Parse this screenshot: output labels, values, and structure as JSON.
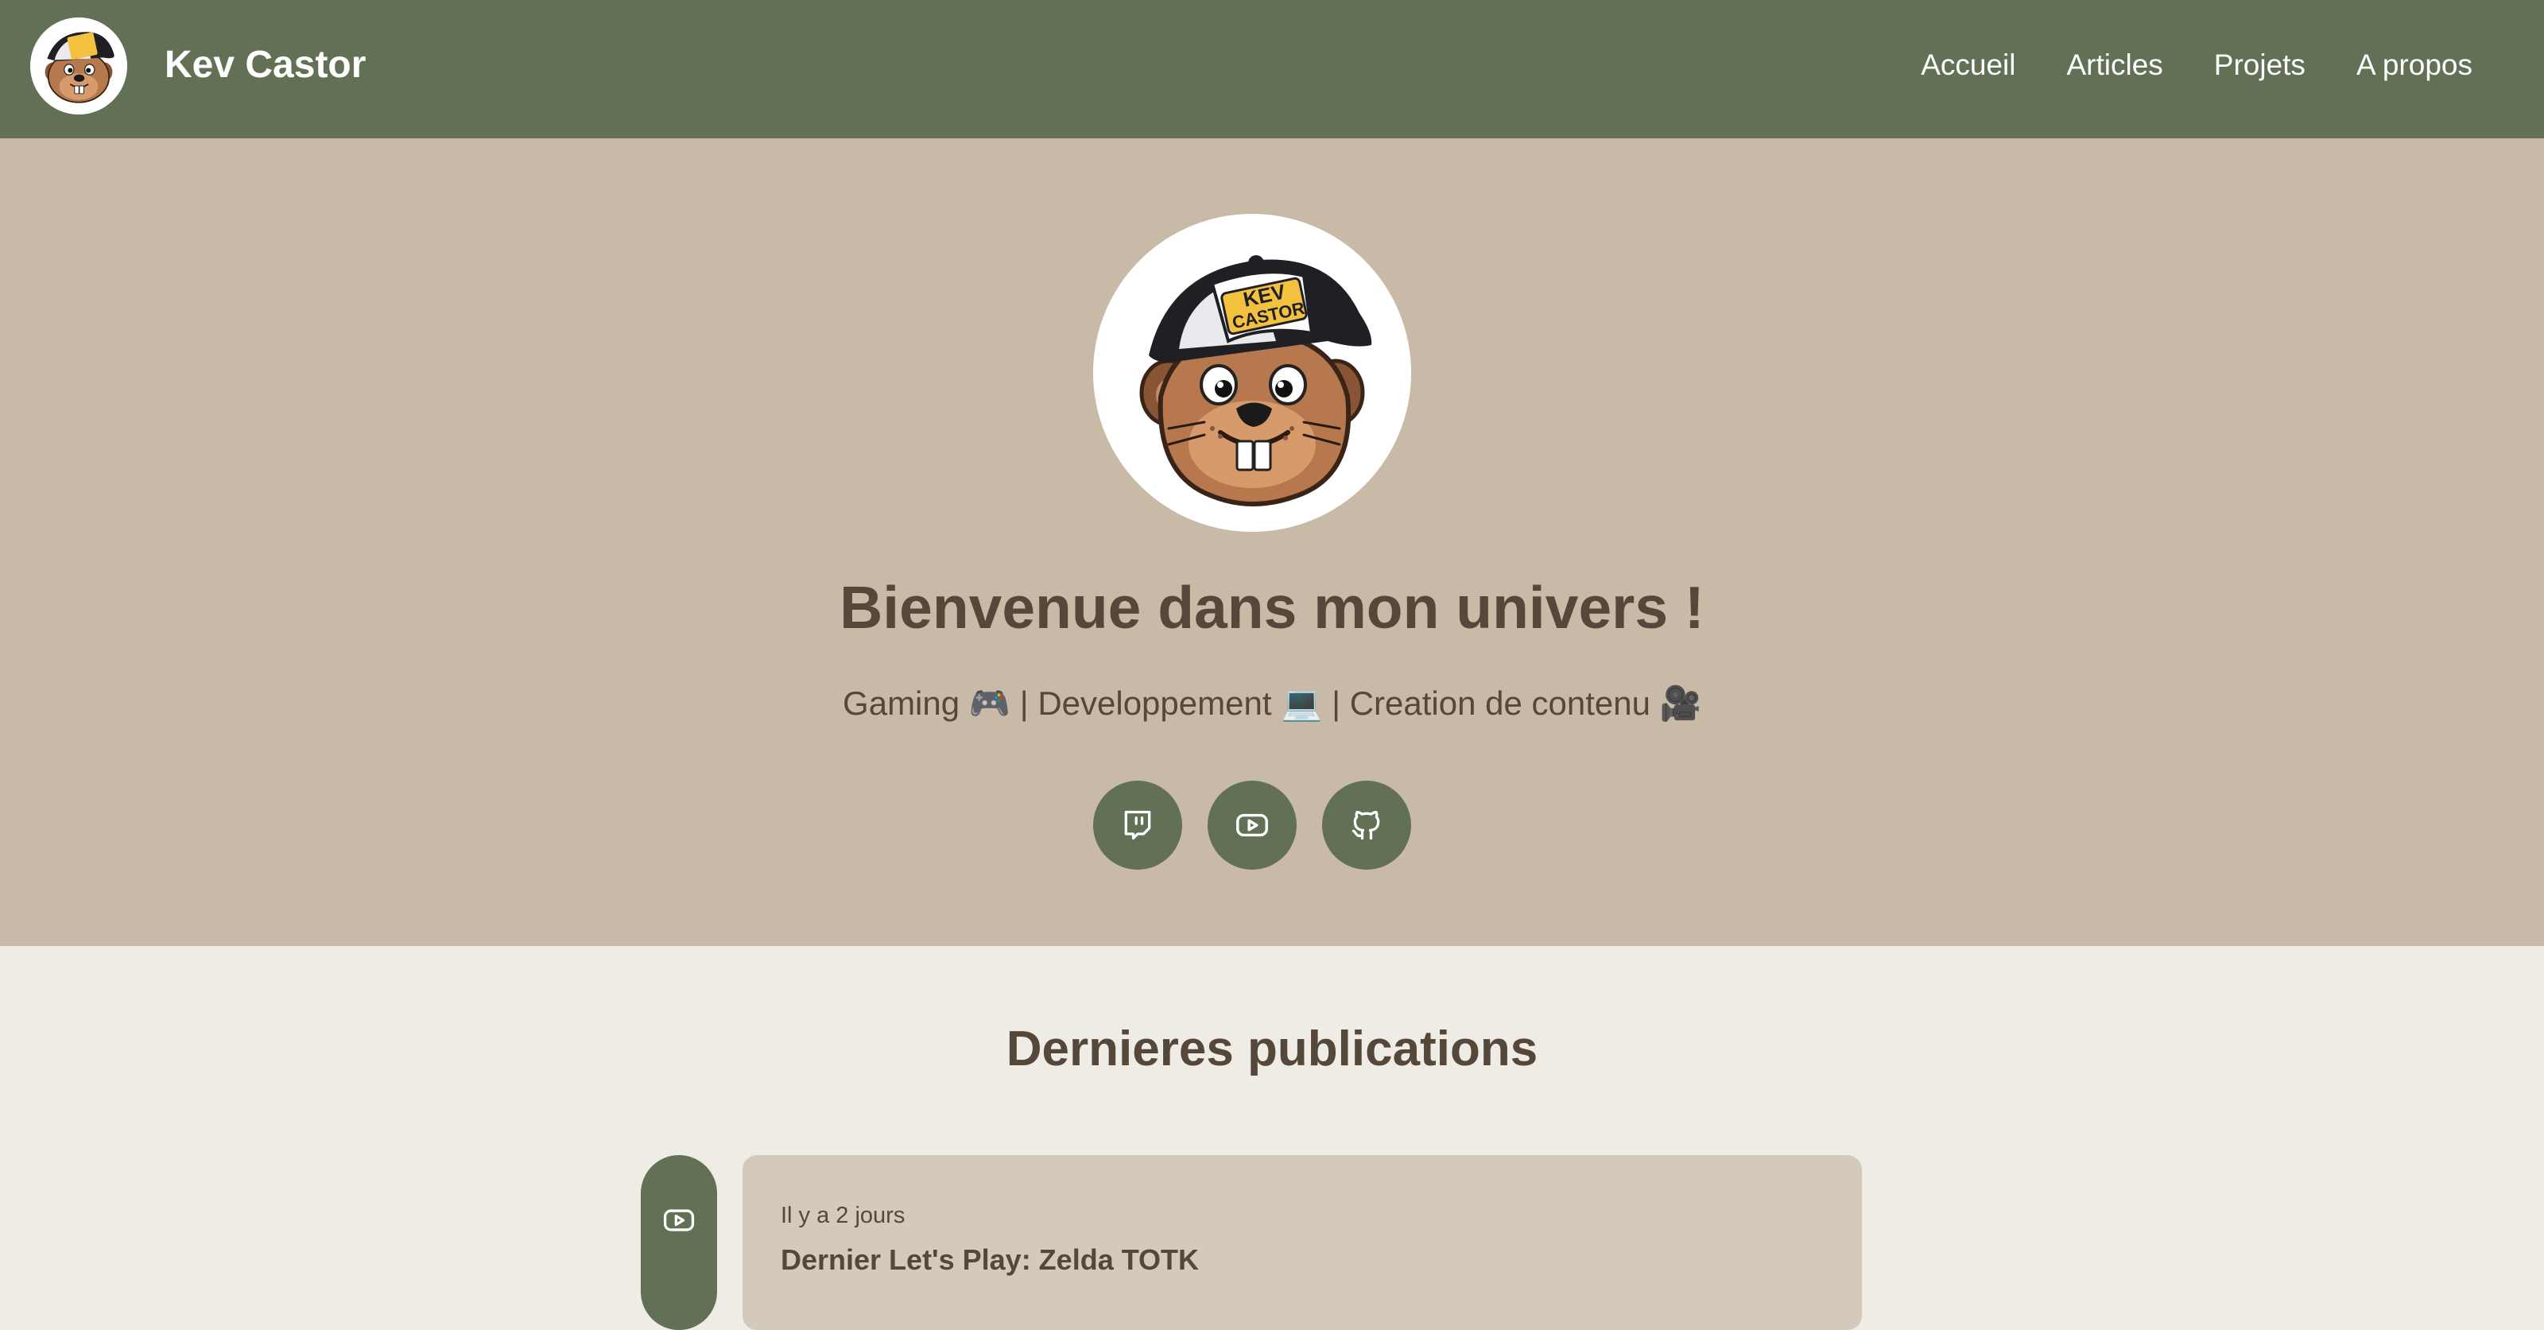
{
  "header": {
    "brand": "Kev Castor",
    "nav": [
      "Accueil",
      "Articles",
      "Projets",
      "A propos"
    ]
  },
  "hero": {
    "title": "Bienvenue dans mon univers !",
    "tagline": "Gaming 🎮 | Developpement 💻 | Creation de contenu 🎥",
    "avatar_cap_text": [
      "KEV",
      "CASTOR"
    ],
    "socials": [
      {
        "icon": "twitch-icon"
      },
      {
        "icon": "youtube-icon"
      },
      {
        "icon": "github-icon"
      }
    ]
  },
  "publications": {
    "title": "Dernieres publications",
    "items": [
      {
        "icon": "youtube-icon",
        "date": "Il y a 2 jours",
        "title": "Dernier Let's Play: Zelda TOTK"
      }
    ]
  },
  "colors": {
    "header": "#627155",
    "hero_bg": "#c9baa8",
    "page_bg": "#efebe5",
    "card_bg": "#d4cabb",
    "text": "#56473b"
  }
}
